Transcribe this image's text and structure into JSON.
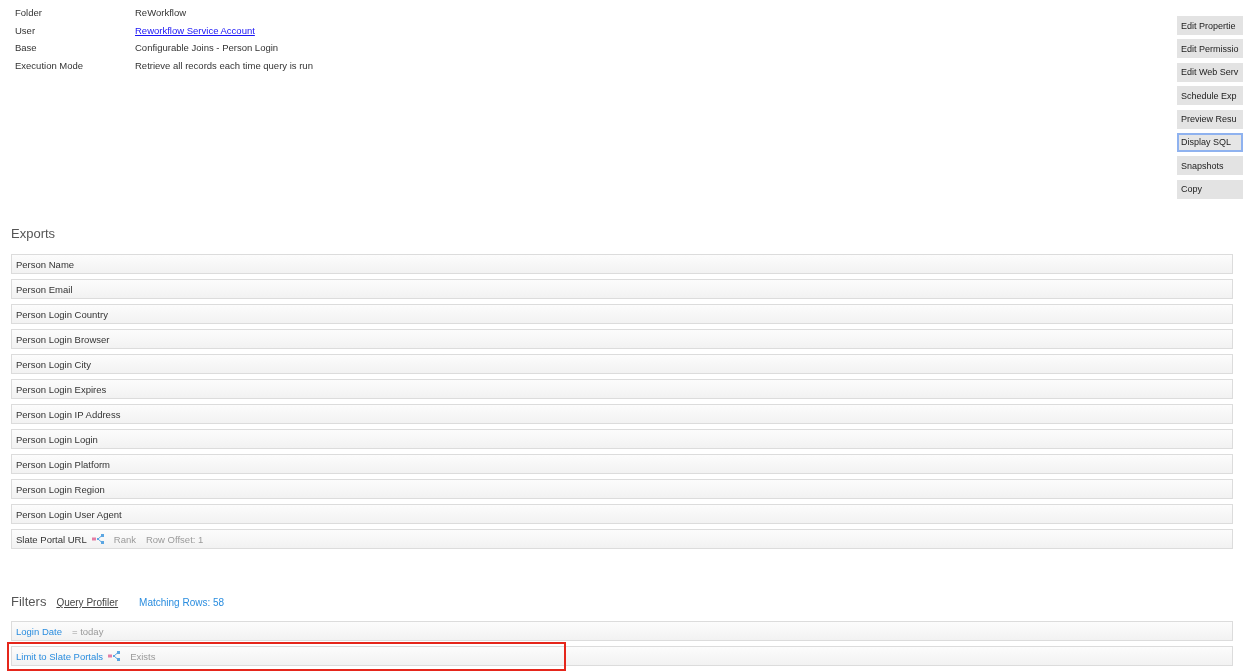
{
  "properties": [
    {
      "label": "Folder",
      "value": "ReWorkflow",
      "kind": "text"
    },
    {
      "label": "User",
      "value": "Reworkflow Service Account",
      "kind": "link"
    },
    {
      "label": "Base",
      "value": "Configurable Joins - Person Login",
      "kind": "text"
    },
    {
      "label": "Execution Mode",
      "value": "Retrieve all records each time query is run",
      "kind": "text"
    }
  ],
  "actions": [
    {
      "label": "Edit Propertie",
      "focused": false
    },
    {
      "label": "Edit Permissio",
      "focused": false
    },
    {
      "label": "Edit Web Serv",
      "focused": false
    },
    {
      "label": "Schedule Exp",
      "focused": false
    },
    {
      "label": "Preview Resu",
      "focused": false
    },
    {
      "label": "Display SQL",
      "focused": true
    },
    {
      "label": "Snapshots",
      "focused": false
    },
    {
      "label": "Copy",
      "focused": false
    }
  ],
  "exports": {
    "title": "Exports",
    "items": [
      {
        "label": "Person Name",
        "joined": false
      },
      {
        "label": "Person Email",
        "joined": false
      },
      {
        "label": "Person Login Country",
        "joined": false
      },
      {
        "label": "Person Login Browser",
        "joined": false
      },
      {
        "label": "Person Login City",
        "joined": false
      },
      {
        "label": "Person Login Expires",
        "joined": false
      },
      {
        "label": "Person Login IP Address",
        "joined": false
      },
      {
        "label": "Person Login Login",
        "joined": false
      },
      {
        "label": "Person Login Platform",
        "joined": false
      },
      {
        "label": "Person Login Region",
        "joined": false
      },
      {
        "label": "Person Login User Agent",
        "joined": false
      },
      {
        "label": "Slate Portal URL",
        "joined": true,
        "details": [
          "Rank",
          "Row Offset: 1"
        ]
      }
    ]
  },
  "filters": {
    "title": "Filters",
    "profiler_link": "Query Profiler",
    "matching_rows": "Matching Rows: 58",
    "items": [
      {
        "label": "Login Date",
        "joined": false,
        "condition": "= today",
        "highlighted": false
      },
      {
        "label": "Limit to Slate Portals",
        "joined": true,
        "condition": "Exists",
        "highlighted": true
      }
    ]
  }
}
